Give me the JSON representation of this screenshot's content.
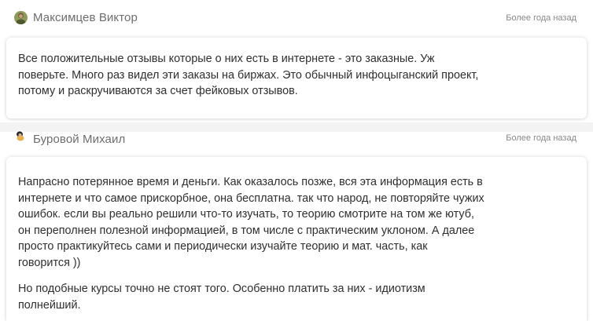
{
  "reviews": [
    {
      "author": "Максимцев Виктор",
      "date": "Более года назад",
      "avatar_icon": "user-photo-avatar",
      "text": "Все положительные отзывы которые о них есть в интернете - это заказные. Уж\nповерьте. Много раз видел эти заказы на биржах. Это обычный инфоцыганский проект,\nпотому и раскручиваются за счет фейковых отзывов."
    },
    {
      "author": "Буровой Михаил",
      "date": "Более года назад",
      "avatar_icon": "user-photo-avatar",
      "text_paragraph_1": "Напрасно потерянное время и деньги. Как оказалось позже, вся эта информация есть в\nинтернете и что самое прискорбное, она бесплатна. так что народ, не повторяйте чужих\nошибок. если вы реально решили что-то изучать, то теорию смотрите на том же ютуб,\nон переполнен полезной информацией, в том числе с практическим уклоном. А далее\nпросто практикуйтесь сами и периодически изучайте теорию и мат. часть, как\nговорится ))",
      "text_paragraph_2": "Но подобные курсы точно не стоят того. Особенно платить за них - идиотизм\nполнейший."
    }
  ],
  "colors": {
    "author": "#6e6e6e",
    "date": "#8a8a8a",
    "body_text": "#2f2f2f",
    "separator": "#f3f3f3"
  }
}
